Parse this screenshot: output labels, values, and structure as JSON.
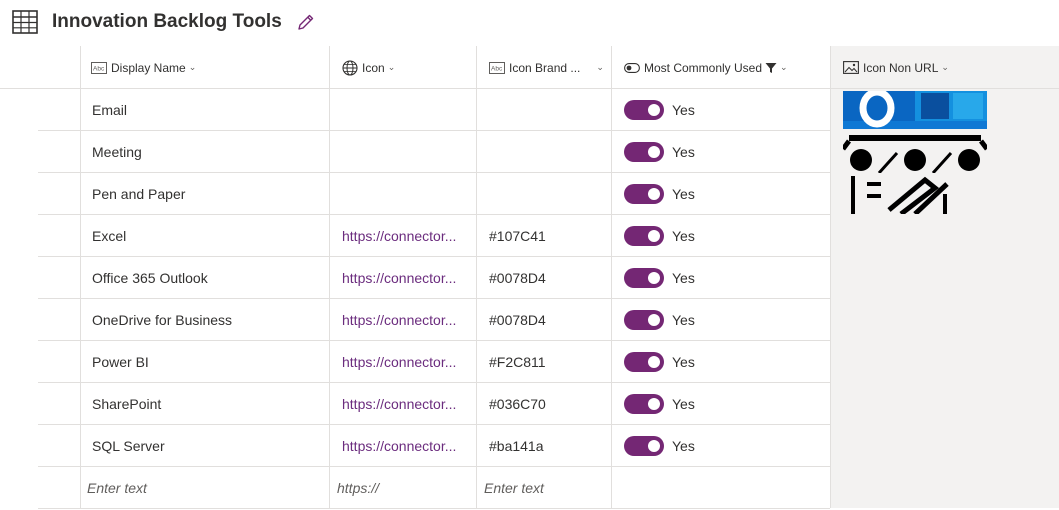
{
  "title": "Innovation Backlog Tools",
  "columns": {
    "display_name": "Display Name",
    "icon": "Icon",
    "icon_brand": "Icon Brand ...",
    "most_used": "Most Commonly Used",
    "icon_non_url": "Icon Non URL"
  },
  "rows": [
    {
      "name": "Email",
      "icon": "",
      "brand": "",
      "used": "Yes"
    },
    {
      "name": "Meeting",
      "icon": "",
      "brand": "",
      "used": "Yes"
    },
    {
      "name": "Pen and Paper",
      "icon": "",
      "brand": "",
      "used": "Yes"
    },
    {
      "name": "Excel",
      "icon": "https://connector...",
      "brand": "#107C41",
      "used": "Yes"
    },
    {
      "name": "Office 365 Outlook",
      "icon": "https://connector...",
      "brand": "#0078D4",
      "used": "Yes"
    },
    {
      "name": "OneDrive for Business",
      "icon": "https://connector...",
      "brand": "#0078D4",
      "used": "Yes"
    },
    {
      "name": "Power BI",
      "icon": "https://connector...",
      "brand": "#F2C811",
      "used": "Yes"
    },
    {
      "name": "SharePoint",
      "icon": "https://connector...",
      "brand": "#036C70",
      "used": "Yes"
    },
    {
      "name": "SQL Server",
      "icon": "https://connector...",
      "brand": "#ba141a",
      "used": "Yes"
    }
  ],
  "new_row": {
    "name_placeholder": "Enter text",
    "icon_placeholder": "https://",
    "brand_placeholder": "Enter text"
  },
  "colors": {
    "accent": "#742774",
    "link": "#6b2c7e",
    "outlook_blue": "#0078D4"
  }
}
